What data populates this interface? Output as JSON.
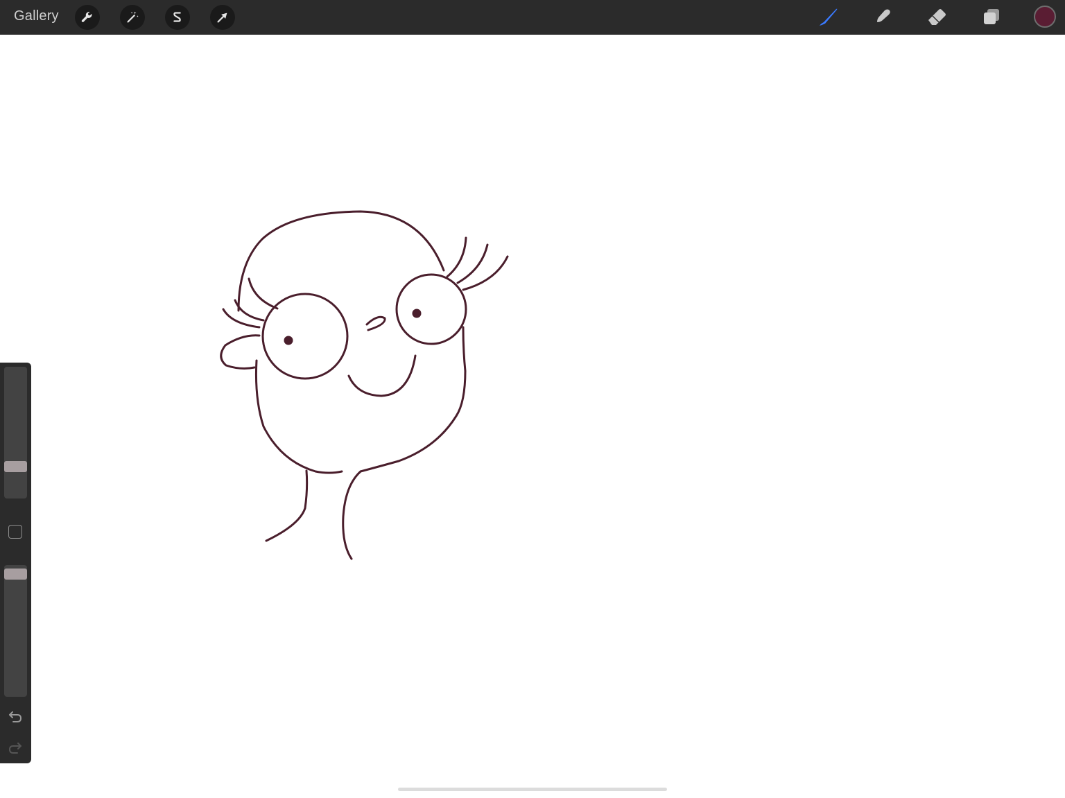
{
  "topbar": {
    "gallery_label": "Gallery",
    "left_tools": [
      "wrench-icon",
      "magic-wand-icon",
      "selection-icon",
      "transform-arrow-icon"
    ],
    "right_tools": [
      "brush-icon",
      "smudge-icon",
      "eraser-icon",
      "layers-icon"
    ],
    "active_tool": "brush",
    "current_color": "#5a1d33"
  },
  "sidebar": {
    "brush_size_level": 0.22,
    "opacity_level": 0.97,
    "undo_icon": "undo-icon",
    "redo_icon": "redo-icon"
  },
  "colors": {
    "accent": "#3a7afe",
    "stroke": "#4a1e2c"
  }
}
